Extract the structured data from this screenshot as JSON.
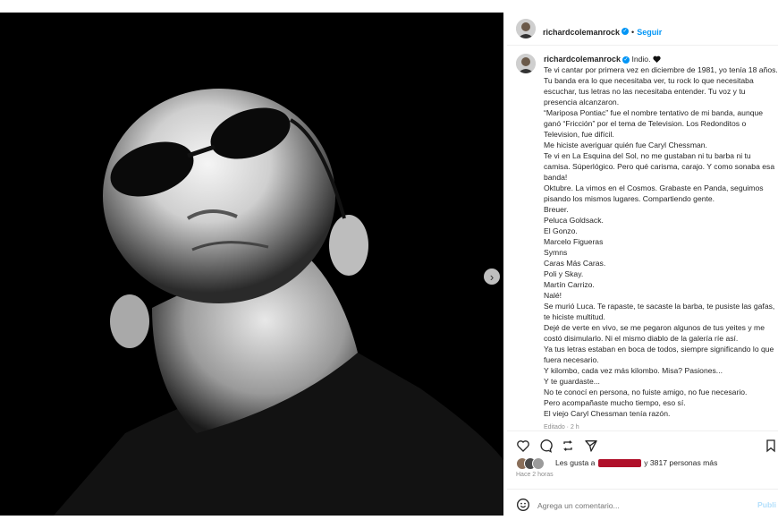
{
  "post": {
    "username": "richardcolemanrock",
    "follow_label": "Seguir",
    "separator": "•",
    "caption_title": "Indio.",
    "caption_lines": [
      "Te vi cantar por primera vez en diciembre de 1981, yo tenía 18 años. Tu banda era lo que necesitaba ver, tu rock lo que necesitaba escuchar, tus letras no las necesitaba entender. Tu voz y tu presencia alcanzaron.",
      "“Mariposa Pontiac” fue el nombre tentativo de mi banda, aunque ganó “Fricción” por el tema de Television. Los Redonditos o Television, fue difícil.",
      "Me hiciste averiguar quién fue Caryl Chessman.",
      "Te vi en La Esquina del Sol, no me gustaban ni tu barba ni tu camisa. Súperlógico. Pero qué carisma, carajo. Y como sonaba esa banda!",
      "Oktubre. La vimos en el Cosmos. Grabaste en Panda, seguimos pisando los mismos lugares. Compartiendo gente.",
      "Breuer.",
      "Peluca Goldsack.",
      "El Gonzo.",
      "Marcelo Figueras",
      "Symns",
      "Caras Más Caras.",
      "Poli y Skay.",
      "Martín Carrizo.",
      "Nalé!",
      "Se murió Luca. Te rapaste, te sacaste la barba, te pusiste las gafas, te hiciste multitud.",
      "Dejé de verte en vivo, se me pegaron algunos de tus yeites y me costó disimularlo. Ni el mismo diablo de la galería ríe así.",
      "Ya tus letras estaban en boca de todos, siempre significando lo que fuera necesario.",
      "Y kilombo, cada vez más kilombo. Misa? Pasiones...",
      "Y te guardaste...",
      "No te conocí en persona, no fuiste amigo, no fue necesario.",
      "Pero acompañaste mucho tiempo, eso sí.",
      "El viejo Caryl Chessman tenía razón."
    ],
    "edited_label": "Editado · 2 h",
    "likes_prefix": "Les gusta a",
    "likes_suffix": "y 3817 personas más",
    "posted_time": "Hace 2 horas",
    "comment_placeholder": "Agrega un comentario...",
    "publish_label": "Publi"
  },
  "colors": {
    "accent": "#0095f6",
    "muted": "#8e8e8e",
    "redaction": "#b0102a"
  },
  "icons": {
    "like": "heart-icon",
    "comment": "comment-icon",
    "share": "share-icon",
    "send": "send-icon",
    "save": "bookmark-icon",
    "emoji": "emoji-icon",
    "next": "chevron-right-icon",
    "verified": "verified-badge-icon",
    "black_heart": "black-heart-icon"
  },
  "carousel": {
    "count": 2,
    "active": 1,
    "next_glyph": "›"
  },
  "verified_glyph": "✓"
}
